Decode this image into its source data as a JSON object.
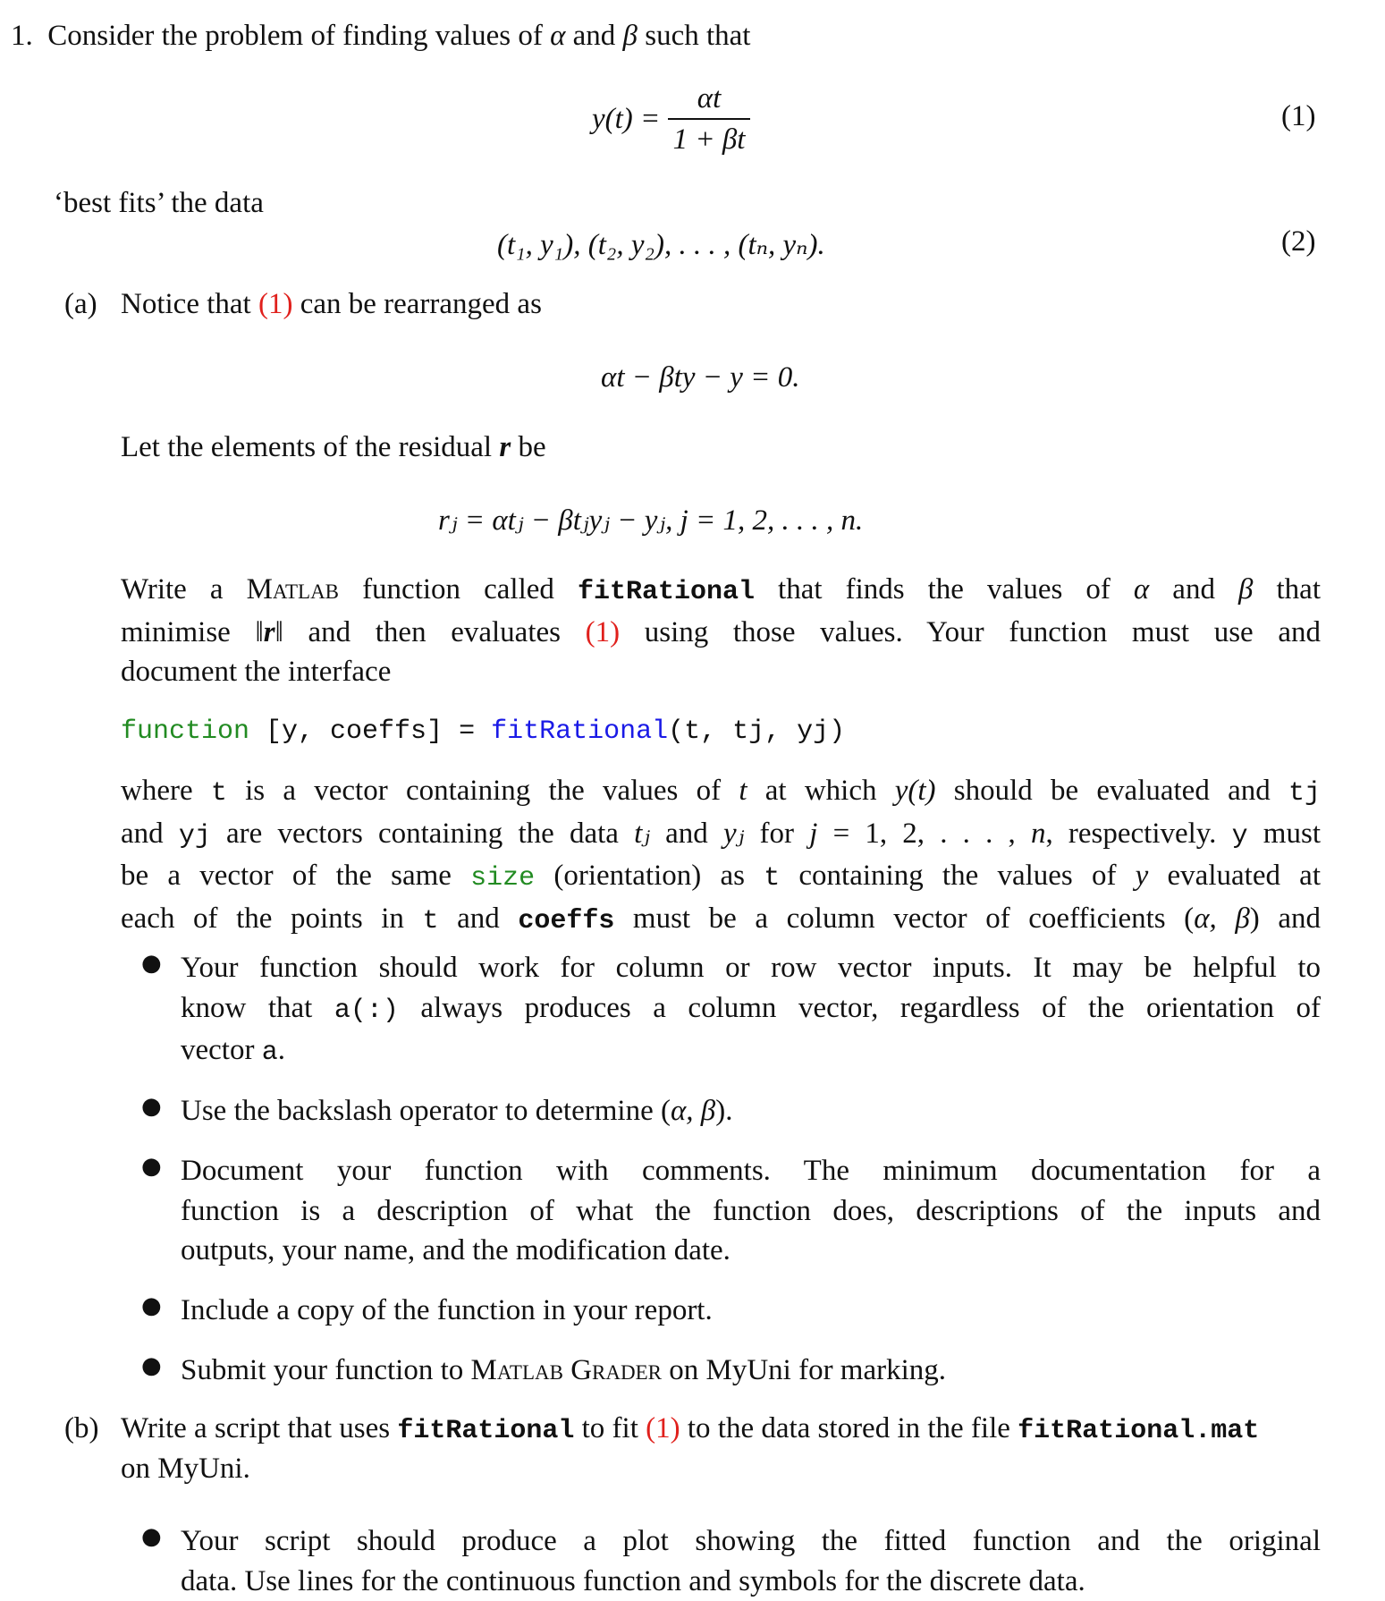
{
  "question": {
    "number": "1.",
    "intro": [
      "Consider the problem of finding values of ",
      "α",
      " and ",
      "β",
      " such that"
    ],
    "eq1": {
      "lhs": "y(t) =",
      "num": "αt",
      "den": "1 + βt",
      "label": "(1)"
    },
    "best_fits": "‘best fits’ the data",
    "eq2": {
      "body": "(t₁, y₁), (t₂, y₂), . . . , (tₙ, yₙ).",
      "label": "(2)"
    }
  },
  "part_a": {
    "label": "(a)",
    "notice": [
      "Notice that ",
      "(1)",
      " can be rearranged as"
    ],
    "rearranged": "αt − βty − y = 0.",
    "residual_intro": [
      "Let the elements of the residual ",
      "r",
      " be"
    ],
    "residual_eq": "rⱼ = αtⱼ − βtⱼyⱼ − yⱼ,    j = 1, 2, . . . , n.",
    "write_para": {
      "l1": [
        "Write a ",
        "Matlab",
        " function called ",
        "fitRational",
        " that finds the values of ",
        "α",
        " and ",
        "β",
        " that"
      ],
      "l2": [
        "minimise ‖",
        "r",
        "‖ and then evaluates ",
        "(1)",
        " using those values. Your function must use and"
      ],
      "l3": "document the interface"
    },
    "signature": {
      "keyword": "function",
      "outputs": " [y, coeffs] = ",
      "name": "fitRational",
      "args": "(t, tj, yj)"
    },
    "where_para": {
      "l1": [
        "where ",
        "t",
        " is a vector containing the values of ",
        "t",
        " at which ",
        "y(t)",
        " should be evaluated and ",
        "tj"
      ],
      "l2": [
        "and ",
        "yj",
        " are vectors containing the data ",
        "tⱼ",
        " and ",
        "yⱼ",
        " for ",
        "j",
        " = 1, 2, . . . , ",
        "n",
        ", respectively. ",
        "y",
        " must"
      ],
      "l3": [
        "be a vector of the same ",
        "size",
        " (orientation) as ",
        "t",
        " containing the values of ",
        "y",
        " evaluated at"
      ],
      "l4": [
        "each of the points in ",
        "t",
        " and ",
        "coeffs",
        " must be a column vector of coefficients (",
        "α, β",
        ") and"
      ]
    },
    "bullets": [
      {
        "lines": [
          [
            "Your function should work for column or row vector inputs. It may be helpful to"
          ],
          [
            "know that ",
            "a(:)",
            " always produces a column vector, regardless of the orientation of"
          ],
          [
            "vector ",
            "a",
            "."
          ]
        ]
      },
      {
        "lines": [
          [
            "Use the backslash operator to determine (",
            "α, β",
            ")."
          ]
        ]
      },
      {
        "lines": [
          [
            "Document your function with comments.  The minimum documentation for a"
          ],
          [
            "function is a description of what the function does, descriptions of the inputs and"
          ],
          [
            "outputs, your name, and the modification date."
          ]
        ]
      },
      {
        "lines": [
          [
            "Include a copy of the function in your report."
          ]
        ]
      },
      {
        "lines": [
          [
            "Submit your function to ",
            "Matlab Grader",
            " on MyUni for marking."
          ]
        ]
      }
    ]
  },
  "part_b": {
    "label": "(b)",
    "l1": [
      "Write a script that uses ",
      "fitRational",
      " to fit ",
      "(1)",
      " to the data stored in the file ",
      "fitRational.mat"
    ],
    "l2": "on MyUni.",
    "bullets": [
      {
        "lines": [
          [
            "Your script should produce a plot showing the fitted function and the original"
          ],
          [
            "data. Use lines for the continuous function and symbols for the discrete data."
          ]
        ]
      }
    ]
  },
  "colors": {
    "reference": "#e0201c",
    "keyword_green": "#228b22",
    "function_blue": "#1a1ae6"
  }
}
